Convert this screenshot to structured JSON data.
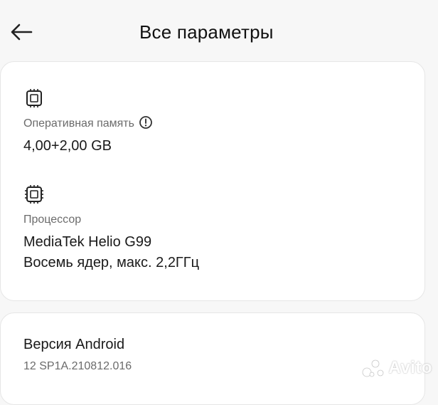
{
  "header": {
    "title": "Все параметры",
    "back_icon": "arrow-left-icon"
  },
  "specs": {
    "ram": {
      "icon": "chip-icon",
      "label": "Оперативная память",
      "info_icon": "info-icon",
      "value": "4,00+2,00 GB"
    },
    "cpu": {
      "icon": "processor-icon",
      "label": "Процессор",
      "value_line1": "MediaTek Helio G99",
      "value_line2": "Восемь ядер, макс. 2,2ГГц"
    }
  },
  "android": {
    "label": "Версия Android",
    "value": "12 SP1A.210812.016"
  },
  "watermark": {
    "text": "Avito"
  }
}
